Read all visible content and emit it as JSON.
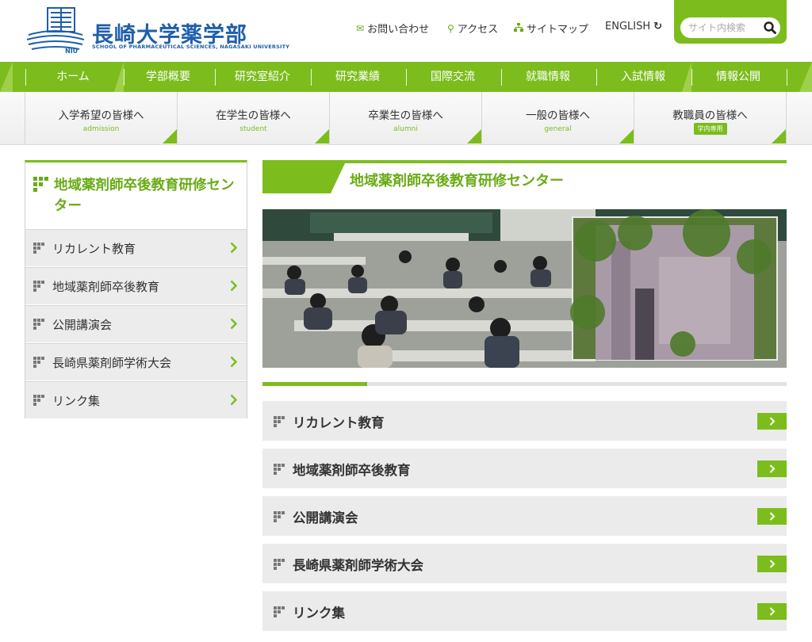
{
  "header": {
    "title": "長崎大学薬学部",
    "subtitle": "SCHOOL OF PHARMACEUTICAL SCIENCES, NAGASAKI UNIVERSITY",
    "util_links": [
      {
        "label": "お問い合わせ",
        "icon": "mail-icon"
      },
      {
        "label": "アクセス",
        "icon": "map-pin-icon"
      },
      {
        "label": "サイトマップ",
        "icon": "sitemap-icon"
      }
    ],
    "english_label": "ENGLISH",
    "search_placeholder": "サイト内検索"
  },
  "main_nav": [
    "ホーム",
    "学部概要",
    "研究室紹介",
    "研究業績",
    "国際交流",
    "就職情報",
    "入試情報",
    "情報公開"
  ],
  "audience_nav": [
    {
      "label": "入学希望の皆様へ",
      "sub": "admission"
    },
    {
      "label": "在学生の皆様へ",
      "sub": "student"
    },
    {
      "label": "卒業生の皆様へ",
      "sub": "alumni"
    },
    {
      "label": "一般の皆様へ",
      "sub": "general"
    },
    {
      "label": "教職員の皆様へ",
      "badge": "学内専用"
    }
  ],
  "sidebar": {
    "title": "地域薬剤師卒後教育研修センター",
    "items": [
      "リカレント教育",
      "地域薬剤師卒後教育",
      "公開講演会",
      "長崎県薬剤師学術大会",
      "リンク集"
    ]
  },
  "content": {
    "title": "地域薬剤師卒後教育研修センター",
    "slider_progress": 0.2,
    "links": [
      "リカレント教育",
      "地域薬剤師卒後教育",
      "公開講演会",
      "長崎県薬剤師学術大会",
      "リンク集"
    ]
  },
  "colors": {
    "accent": "#7cbd1d",
    "accent_text": "#6aab16",
    "brand_blue": "#1f5fa9"
  }
}
